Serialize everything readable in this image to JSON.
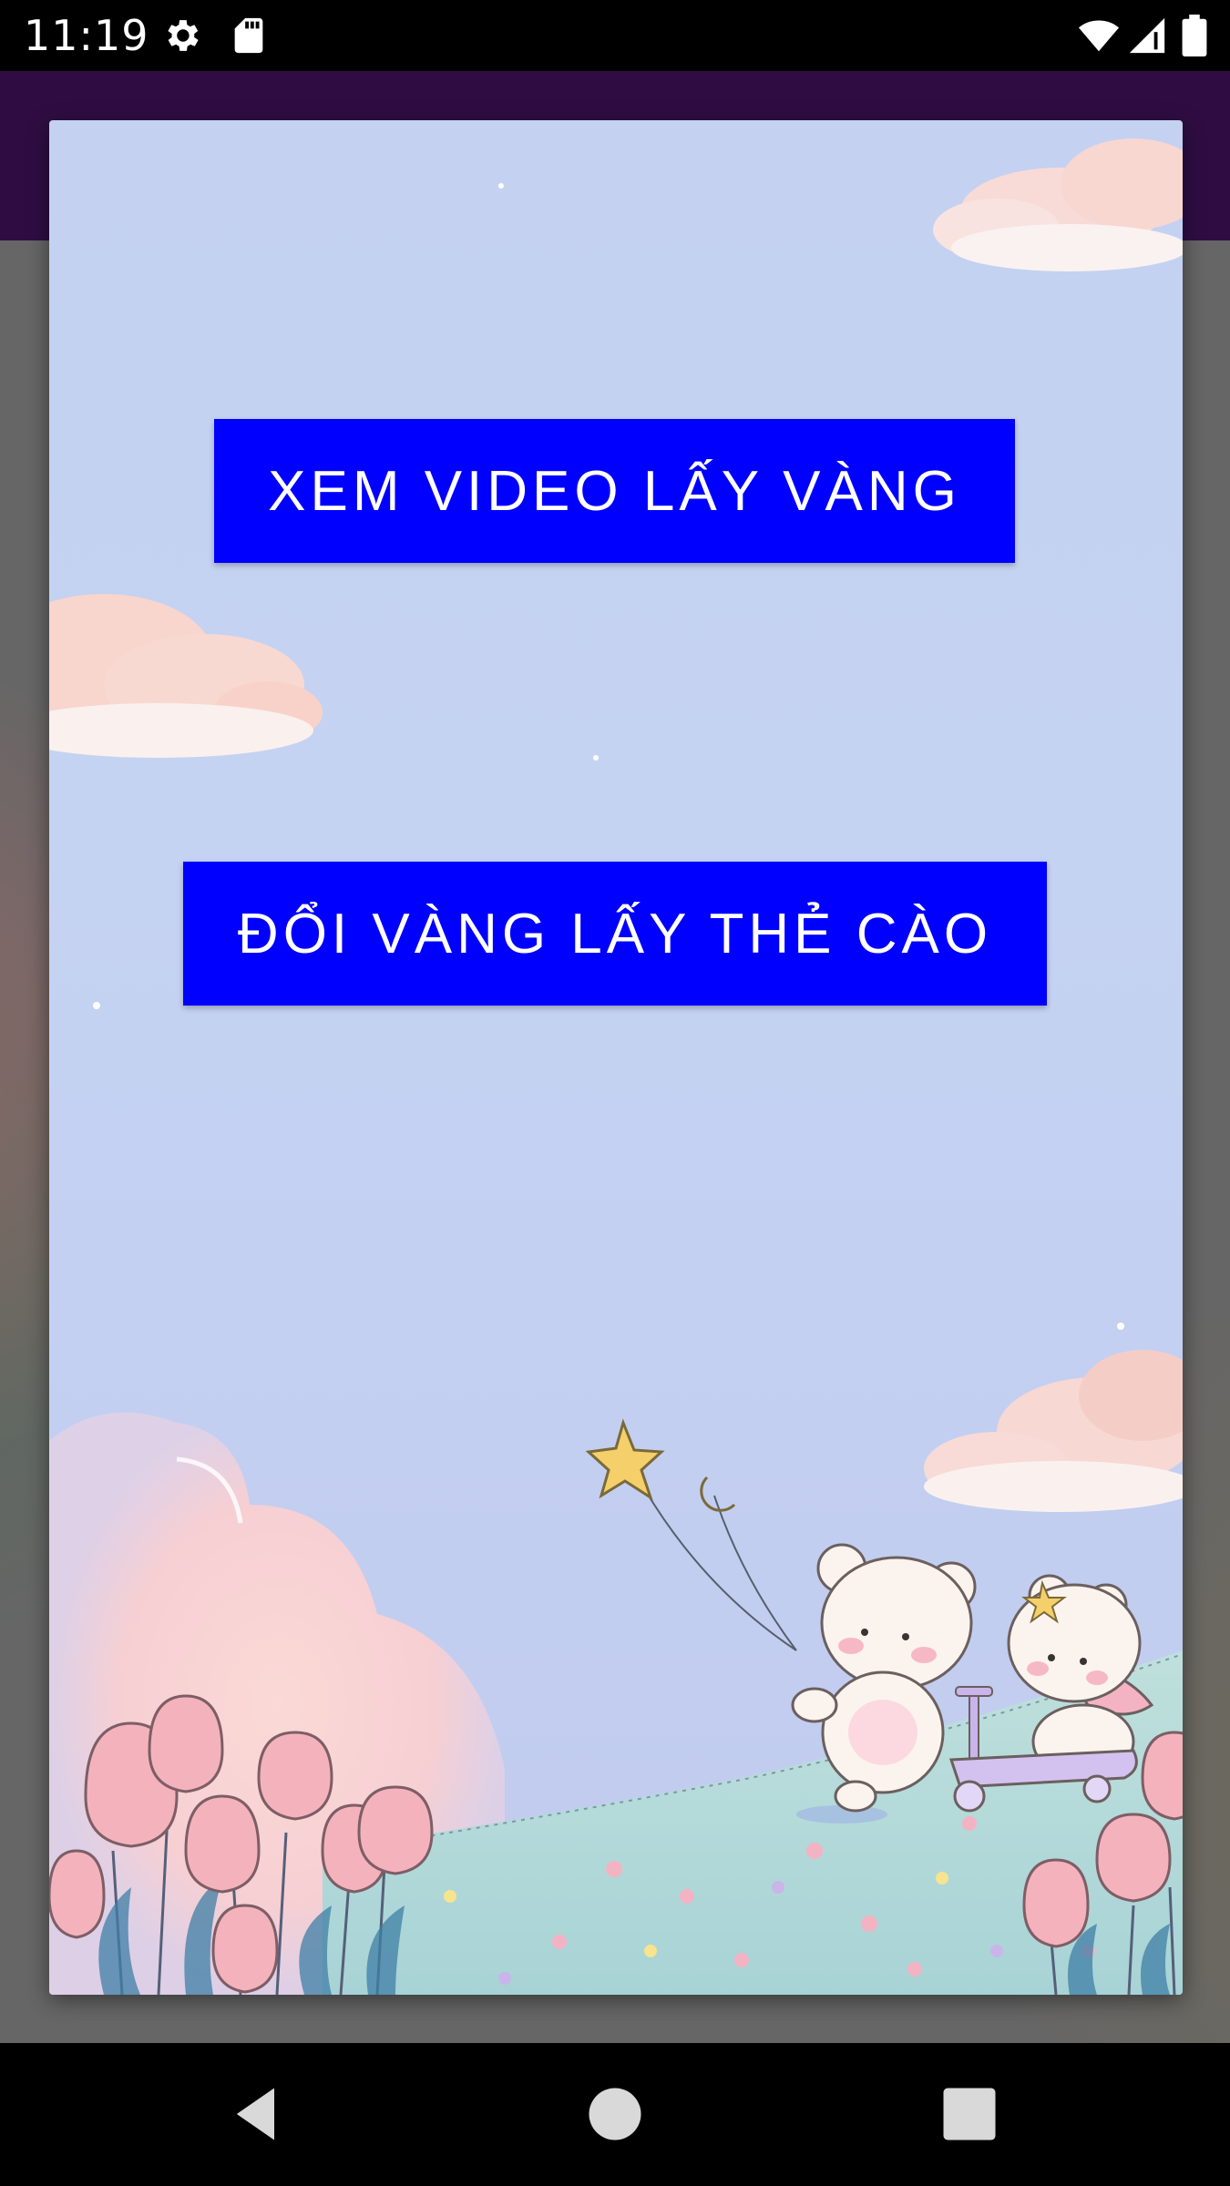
{
  "status_bar": {
    "time": "11:19",
    "icons": [
      "gear-icon",
      "sd-card-icon",
      "wifi-icon",
      "cell-signal-icon",
      "battery-icon"
    ]
  },
  "dialog": {
    "buttons": {
      "watch_video": "XEM VIDEO LẤY VÀNG",
      "exchange_gold": "ĐỔI VÀNG LẤY THẺ CÀO"
    },
    "button_color": "#0000ff",
    "button_text_color": "#ffffff",
    "background_image": "pastel-sky-bears-kite-tulips-illustration"
  },
  "navigation_bar": {
    "icons": [
      "back-icon",
      "home-icon",
      "recents-icon"
    ]
  },
  "colors": {
    "app_toolbar": "#2f0d43",
    "scrim": "#6c6c6c",
    "sky": "#c4d1f1"
  }
}
